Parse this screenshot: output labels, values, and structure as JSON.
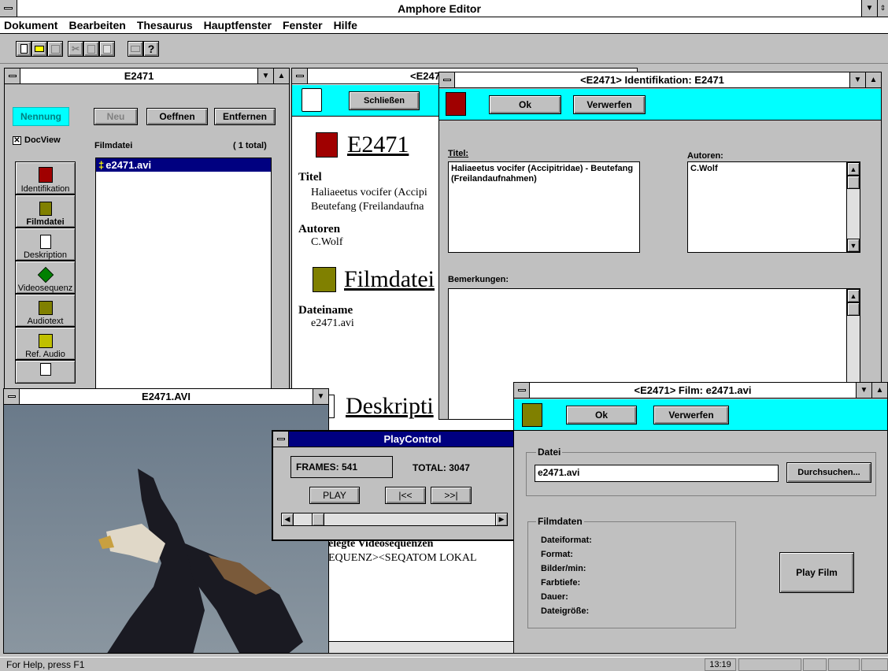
{
  "app": {
    "title": "Amphore Editor"
  },
  "menu": [
    "Dokument",
    "Bearbeiten",
    "Thesaurus",
    "Hauptfenster",
    "Fenster",
    "Hilfe"
  ],
  "toolbar": {
    "icons": [
      "new-doc-icon",
      "open-icon",
      "save-icon",
      "cut-icon",
      "copy-icon",
      "paste-icon",
      "print-icon",
      "help-icon"
    ],
    "help_glyph": "?"
  },
  "doc_window": {
    "title": "E2471",
    "nennung": "Nennung",
    "neu": "Neu",
    "oeffnen": "Oeffnen",
    "entfernen": "Entfernen",
    "docview": "DocView",
    "list_header": "Filmdatei",
    "list_count": "( 1 total)",
    "files": [
      "e2471.avi"
    ],
    "nav": [
      "Identifikation",
      "Filmdatei",
      "Deskription",
      "Videosequenz",
      "Audiotext",
      "Ref. Audio"
    ]
  },
  "preview": {
    "title": "<E247",
    "close": "Schließen",
    "heading": "E2471",
    "titel_label": "Titel",
    "titel_lines": [
      "Haliaeetus vocifer (Accipi",
      "Beutefang (Freilandaufna"
    ],
    "autoren_label": "Autoren",
    "autoren": "C.Wolf",
    "filmdatei_heading": "Filmdatei",
    "dateiname_label": "Dateiname",
    "dateiname": "e2471.avi",
    "deskription": "Deskripti",
    "seq_label": "elegte Videosequenzen",
    "seq_text": "EQUENZ><SEQATOM LOKAL"
  },
  "ident": {
    "title": "<E2471> Identifikation: E2471",
    "ok": "Ok",
    "verwerfen": "Verwerfen",
    "titel_label": "Titel:",
    "titel_value": "Haliaeetus vocifer (Accipitridae) - Beutefang (Freilandaufnahmen)",
    "autoren_label": "Autoren:",
    "autoren_value": "C.Wolf",
    "bemerkungen_label": "Bemerkungen:"
  },
  "avi": {
    "title": "E2471.AVI"
  },
  "playcontrol": {
    "title": "PlayControl",
    "frames": "FRAMES: 541",
    "total": "TOTAL: 3047",
    "play": "PLAY",
    "back": "|<<",
    "fwd": ">>|",
    "position": 0.2
  },
  "film": {
    "title": "<E2471> Film: e2471.avi",
    "ok": "Ok",
    "verwerfen": "Verwerfen",
    "datei_label": "Datei",
    "datei_value": "e2471.avi",
    "durchsuchen": "Durchsuchen...",
    "filmdaten_label": "Filmdaten",
    "fields": [
      "Dateiformat:",
      "Format:",
      "Bilder/min:",
      "Farbtiefe:",
      "Dauer:",
      "Dateigröße:"
    ],
    "play_film": "Play Film"
  },
  "status": {
    "help": "For Help, press F1",
    "time": "13:19"
  }
}
